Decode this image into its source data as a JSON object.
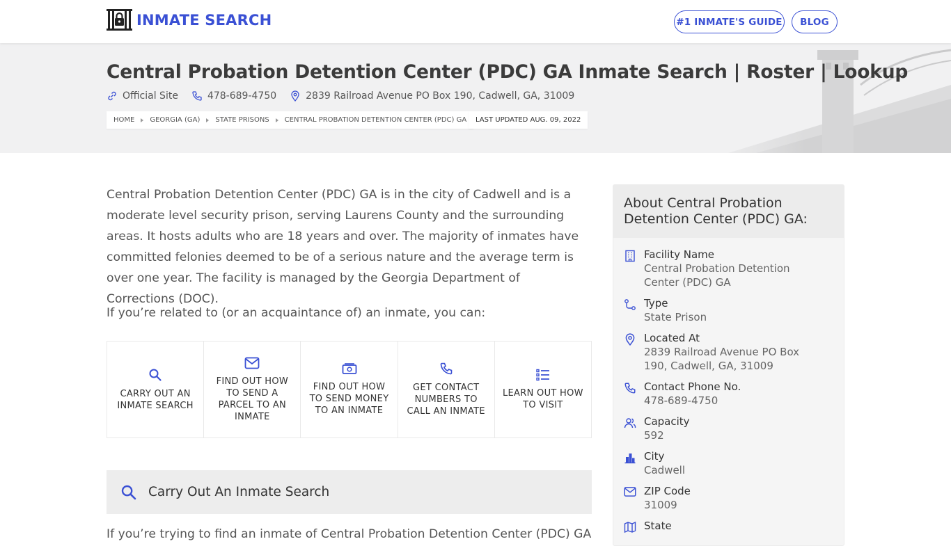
{
  "header": {
    "logo_text": "INMATE SEARCH",
    "nav": [
      {
        "label": "#1 INMATE'S GUIDE"
      },
      {
        "label": "BLOG"
      }
    ]
  },
  "hero": {
    "title": "Central Probation Detention Center (PDC) GA Inmate Search | Roster | Lookup",
    "official_site": "Official Site",
    "phone": "478-689-4750",
    "address": "2839 Railroad Avenue PO Box 190, Cadwell, GA, 31009",
    "breadcrumbs": [
      "HOME",
      "GEORGIA (GA)",
      "STATE PRISONS",
      "CENTRAL PROBATION DETENTION CENTER (PDC) GA"
    ],
    "updated": "LAST UPDATED AUG. 09, 2022"
  },
  "main": {
    "intro": "Central Probation Detention Center (PDC) GA is in the city of Cadwell and is a moderate level security prison, serving Laurens County and the surrounding areas. It hosts adults who are 18 years and over. The majority of inmates have committed felonies deemed to be of a serious nature and the average term is over one year. The facility is managed by the Georgia Department of Corrections (DOC).",
    "lead": "If you’re related to (or an acquaintance of) an inmate, you can:",
    "actions": [
      {
        "label": "CARRY OUT AN INMATE SEARCH",
        "icon": "search-icon"
      },
      {
        "label": "FIND OUT HOW TO SEND A PARCEL TO AN INMATE",
        "icon": "mail-icon"
      },
      {
        "label": "FIND OUT HOW TO SEND MONEY TO AN INMATE",
        "icon": "money-icon"
      },
      {
        "label": "GET CONTACT NUMBERS TO CALL AN INMATE",
        "icon": "phone-icon"
      },
      {
        "label": "LEARN OUT HOW TO VISIT",
        "icon": "list-icon"
      }
    ],
    "section_title": "Carry Out An Inmate Search",
    "section_text": "If you’re trying to find an inmate of Central Probation Detention Center (PDC) GA"
  },
  "sidebar": {
    "title": "About Central Probation Detention Center (PDC) GA:",
    "rows": [
      {
        "label": "Facility Name",
        "value": "Central Probation Detention Center (PDC) GA",
        "icon": "building-icon"
      },
      {
        "label": "Type",
        "value": "State Prison",
        "icon": "route-icon"
      },
      {
        "label": "Located At",
        "value": "2839 Railroad Avenue PO Box 190, Cadwell, GA, 31009",
        "icon": "map-pin-icon"
      },
      {
        "label": "Contact Phone No.",
        "value": "478-689-4750",
        "icon": "phone-icon"
      },
      {
        "label": "Capacity",
        "value": "592",
        "icon": "users-icon"
      },
      {
        "label": "City",
        "value": "Cadwell",
        "icon": "city-icon"
      },
      {
        "label": "ZIP Code",
        "value": "31009",
        "icon": "mail-icon"
      },
      {
        "label": "State",
        "value": "",
        "icon": "map-icon"
      }
    ]
  },
  "colors": {
    "accent": "#3a50d4",
    "hero_bg": "#f1f1f2",
    "sidebar_bg": "#f5f5f5"
  }
}
